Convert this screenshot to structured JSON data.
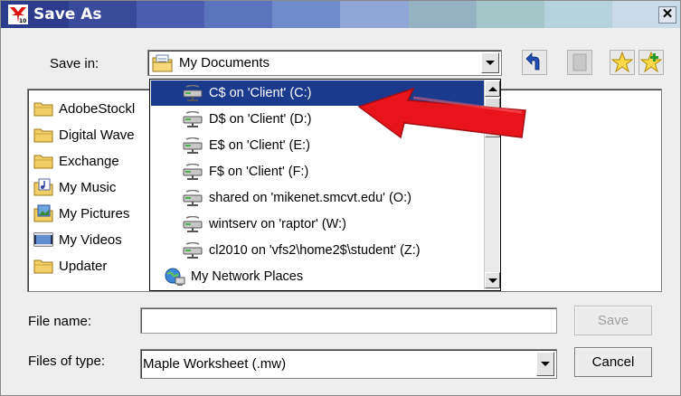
{
  "window": {
    "title": "Save As",
    "close_glyph": "✕",
    "title_colors": [
      "#2c3b8c",
      "#3a4a9a",
      "#4a5dae",
      "#5a74be",
      "#6e8cca",
      "#8fa6d6",
      "#93b2c2",
      "#a3c7c9",
      "#b5d3dd",
      "#c8dbe6"
    ]
  },
  "save_in": {
    "label": "Save in:",
    "value": "My Documents",
    "icon": "folder-documents-icon"
  },
  "toolbar": {
    "buttons": [
      {
        "name": "up-folder-button",
        "icon": "up-arrow-icon"
      },
      {
        "name": "new-folder-button",
        "icon": "blank-icon"
      },
      {
        "name": "favorites-button",
        "icon": "star-icon"
      },
      {
        "name": "add-favorite-button",
        "icon": "star-add-icon"
      }
    ]
  },
  "files": [
    {
      "label": "AdobeStockl",
      "icon": "folder-icon"
    },
    {
      "label": "Digital Wave",
      "icon": "folder-icon"
    },
    {
      "label": "Exchange",
      "icon": "folder-icon"
    },
    {
      "label": "My Music",
      "icon": "music-folder-icon"
    },
    {
      "label": "My Pictures",
      "icon": "pictures-folder-icon"
    },
    {
      "label": "My Videos",
      "icon": "videos-folder-icon"
    },
    {
      "label": "Updater",
      "icon": "folder-icon"
    }
  ],
  "dropdown": {
    "items": [
      {
        "label": "C$ on 'Client' (C:)",
        "icon": "network-drive-icon",
        "selected": true
      },
      {
        "label": "D$ on 'Client' (D:)",
        "icon": "network-drive-icon"
      },
      {
        "label": "E$ on 'Client' (E:)",
        "icon": "network-drive-icon"
      },
      {
        "label": "F$ on 'Client' (F:)",
        "icon": "network-drive-icon"
      },
      {
        "label": "shared on 'mikenet.smcvt.edu' (O:)",
        "icon": "network-drive-icon"
      },
      {
        "label": "wintserv on 'raptor' (W:)",
        "icon": "network-drive-icon"
      },
      {
        "label": "cl2010 on 'vfs2\\home2$\\student' (Z:)",
        "icon": "network-drive-icon"
      },
      {
        "label": "My Network Places",
        "icon": "network-places-icon"
      }
    ],
    "selection_color": "#1a3a8e"
  },
  "annotation": {
    "icon": "red-arrow-icon",
    "color": "#e8141c"
  },
  "file_name": {
    "label": "File name:",
    "value": ""
  },
  "files_of_type": {
    "label": "Files of type:",
    "value": "Maple Worksheet (.mw)"
  },
  "buttons": {
    "save": "Save",
    "cancel": "Cancel"
  }
}
